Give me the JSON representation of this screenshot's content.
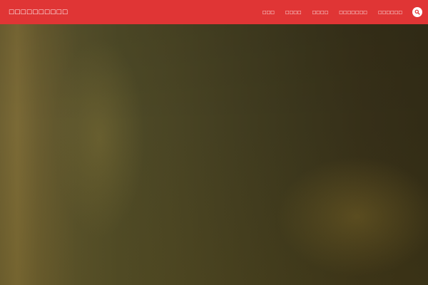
{
  "header": {
    "site_title": "□□□□□□□□□□",
    "nav": [
      {
        "label": "□□□"
      },
      {
        "label": "□□□□"
      },
      {
        "label": "□□□□"
      },
      {
        "label": "□□□□□□□"
      },
      {
        "label": "□□□□□□"
      }
    ],
    "search_icon": "search-icon"
  },
  "colors": {
    "header_bg": "#e03535",
    "header_text": "#ffffff",
    "hero_tone": "#4a4524"
  }
}
